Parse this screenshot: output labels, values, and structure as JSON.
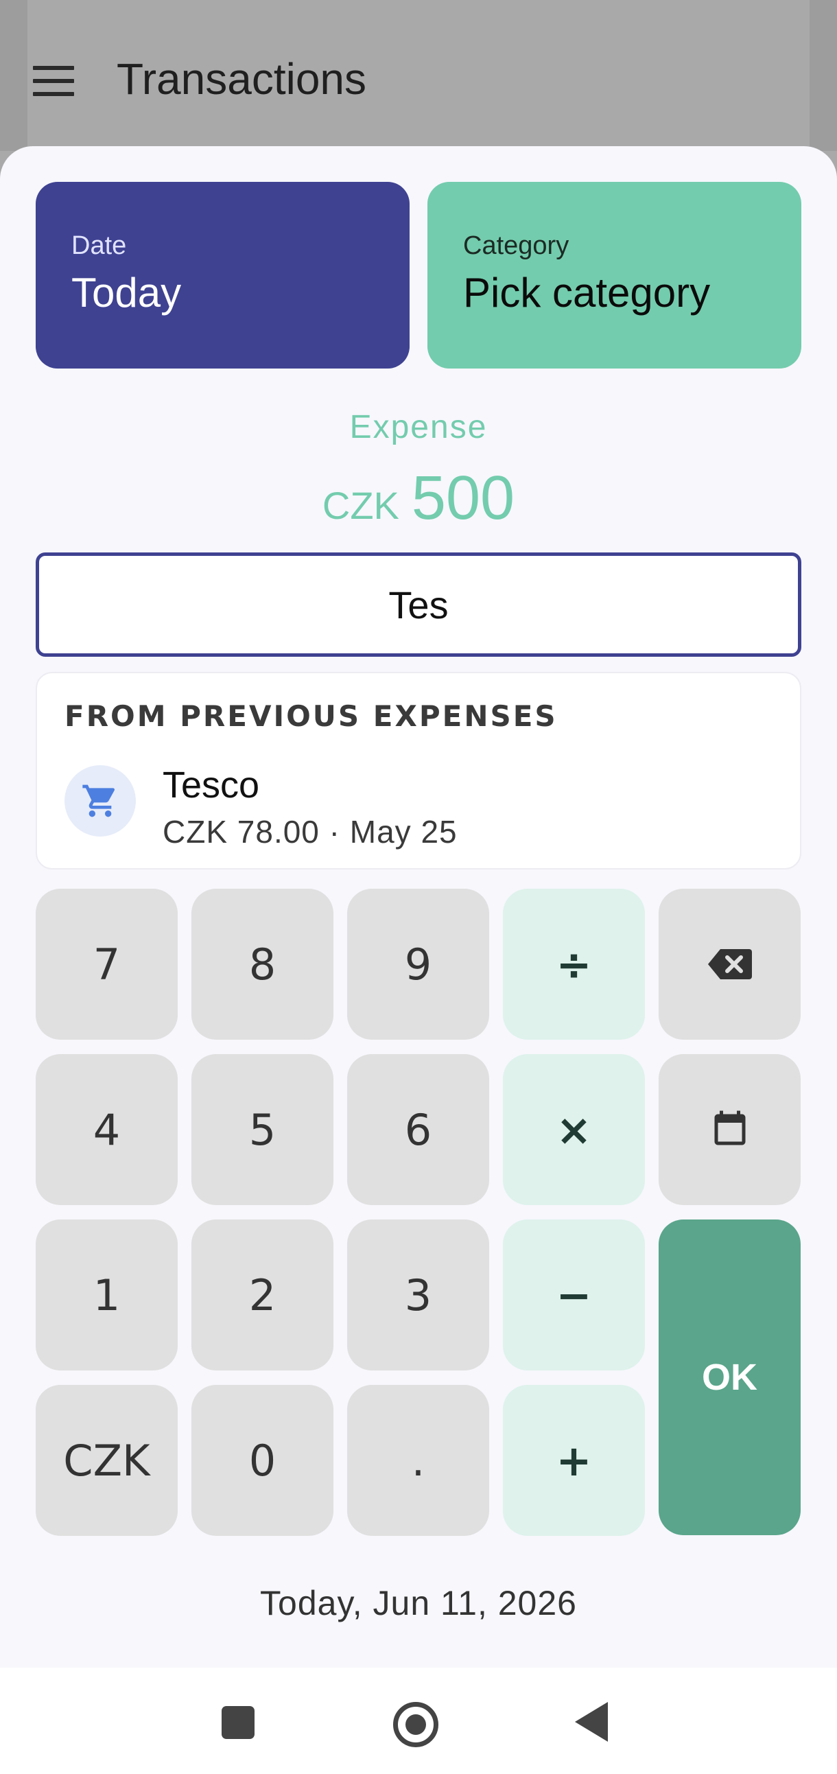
{
  "app_bar": {
    "title": "Transactions",
    "menu_icon": "menu-icon"
  },
  "tiles": {
    "date": {
      "label": "Date",
      "value": "Today",
      "color": "#3f4291"
    },
    "category": {
      "label": "Category",
      "value": "Pick category",
      "color": "#73ccad"
    }
  },
  "transaction": {
    "type": "Expense",
    "currency": "CZK",
    "amount": "500"
  },
  "note_input": {
    "value": "Tes"
  },
  "suggestions": {
    "header": "FROM PREVIOUS EXPENSES",
    "items": [
      {
        "icon": "shopping-cart-icon",
        "name": "Tesco",
        "detail": "CZK 78.00 · May 25"
      }
    ]
  },
  "keypad": {
    "k7": "7",
    "k8": "8",
    "k9": "9",
    "divide": "÷",
    "backspace_icon": "backspace-icon",
    "k4": "4",
    "k5": "5",
    "k6": "6",
    "multiply": "×",
    "calendar_icon": "calendar-icon",
    "k1": "1",
    "k2": "2",
    "k3": "3",
    "minus": "−",
    "ok": "OK",
    "currency": "CZK",
    "k0": "0",
    "dot": ".",
    "plus": "+"
  },
  "footer": {
    "date": "Today, Jun 11, 2026"
  },
  "colors": {
    "accent": "#3f4291",
    "expense": "#73ccad",
    "ok": "#5aa58b",
    "operator": "#dff2ec"
  }
}
